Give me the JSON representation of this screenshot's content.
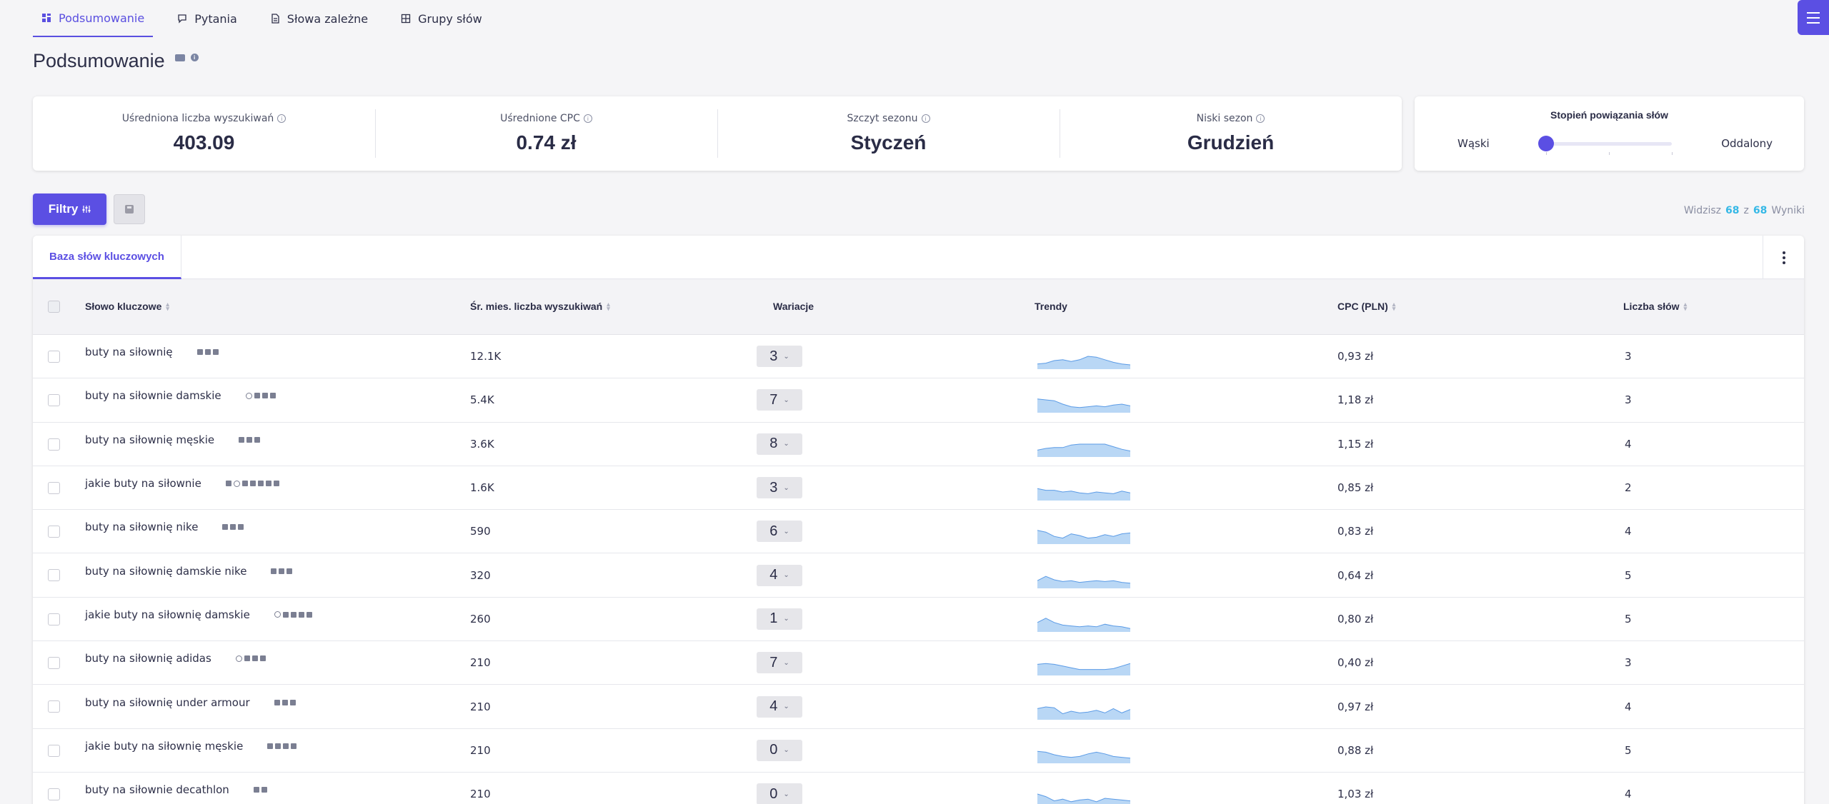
{
  "nav": {
    "tabs": [
      {
        "label": "Podsumowanie",
        "active": true
      },
      {
        "label": "Pytania",
        "active": false
      },
      {
        "label": "Słowa zależne",
        "active": false
      },
      {
        "label": "Grupy słów",
        "active": false
      }
    ]
  },
  "page": {
    "title": "Podsumowanie"
  },
  "stats": [
    {
      "label": "Uśredniona liczba wyszukiwań",
      "value": "403.09"
    },
    {
      "label": "Uśrednione CPC",
      "value": "0.74 zł"
    },
    {
      "label": "Szczyt sezonu",
      "value": "Styczeń"
    },
    {
      "label": "Niski sezon",
      "value": "Grudzień"
    }
  ],
  "relation": {
    "title": "Stopień powiązania słów",
    "left": "Wąski",
    "right": "Oddalony",
    "level": 0
  },
  "toolbar": {
    "filter_label": "Filtry"
  },
  "results": {
    "prefix": "Widzisz",
    "shown": "68",
    "sep": "z",
    "total": "68",
    "suffix": "Wyniki"
  },
  "table": {
    "tab_label": "Baza słów kluczowych",
    "headers": {
      "keyword": "Słowo kluczowe",
      "volume": "Śr. mies. liczba wyszukiwań",
      "variations": "Wariacje",
      "trends": "Trendy",
      "cpc": "CPC (PLN)",
      "words": "Liczba słów"
    },
    "rows": [
      {
        "keyword": "buty na siłownię",
        "icons": [
          "doc",
          "bag",
          "list"
        ],
        "volume": "12.1K",
        "variations": "3",
        "cpc": "0,93 zł",
        "words": "3",
        "trend": [
          0.3,
          0.35,
          0.5,
          0.55,
          0.45,
          0.55,
          0.75,
          0.7,
          0.55,
          0.4,
          0.3,
          0.25
        ]
      },
      {
        "keyword": "buty na siłownie damskie",
        "icons": [
          "google",
          "doc",
          "bag",
          "list"
        ],
        "volume": "5.4K",
        "variations": "7",
        "cpc": "1,18 zł",
        "words": "3",
        "trend": [
          0.8,
          0.75,
          0.7,
          0.5,
          0.35,
          0.3,
          0.35,
          0.4,
          0.35,
          0.45,
          0.5,
          0.4
        ]
      },
      {
        "keyword": "buty na siłownię męskie",
        "icons": [
          "doc",
          "bag",
          "list"
        ],
        "volume": "3.6K",
        "variations": "8",
        "cpc": "1,15 zł",
        "words": "4",
        "trend": [
          0.4,
          0.5,
          0.55,
          0.55,
          0.7,
          0.75,
          0.75,
          0.75,
          0.75,
          0.6,
          0.45,
          0.35
        ]
      },
      {
        "keyword": "jakie buty na siłownie",
        "icons": [
          "chat",
          "google",
          "img",
          "link",
          "bag",
          "list",
          "video"
        ],
        "volume": "1.6K",
        "variations": "3",
        "cpc": "0,85 zł",
        "words": "2",
        "trend": [
          0.7,
          0.6,
          0.6,
          0.5,
          0.55,
          0.45,
          0.4,
          0.5,
          0.45,
          0.4,
          0.55,
          0.45
        ]
      },
      {
        "keyword": "buty na siłownię nike",
        "icons": [
          "doc",
          "bag",
          "list"
        ],
        "volume": "590",
        "variations": "6",
        "cpc": "0,83 zł",
        "words": "4",
        "trend": [
          0.8,
          0.7,
          0.45,
          0.35,
          0.6,
          0.5,
          0.35,
          0.4,
          0.55,
          0.45,
          0.6,
          0.65
        ]
      },
      {
        "keyword": "buty na siłownię damskie nike",
        "icons": [
          "doc",
          "bag",
          "list"
        ],
        "volume": "320",
        "variations": "4",
        "cpc": "0,64 zł",
        "words": "5",
        "trend": [
          0.45,
          0.7,
          0.5,
          0.4,
          0.45,
          0.35,
          0.4,
          0.45,
          0.4,
          0.45,
          0.35,
          0.3
        ]
      },
      {
        "keyword": "jakie buty na siłownię damskie",
        "icons": [
          "google",
          "img",
          "link",
          "bag",
          "list"
        ],
        "volume": "260",
        "variations": "1",
        "cpc": "0,80 zł",
        "words": "5",
        "trend": [
          0.55,
          0.8,
          0.55,
          0.4,
          0.35,
          0.3,
          0.35,
          0.3,
          0.45,
          0.35,
          0.3,
          0.2
        ]
      },
      {
        "keyword": "buty na siłownię adidas",
        "icons": [
          "google",
          "doc",
          "bag",
          "list"
        ],
        "volume": "210",
        "variations": "7",
        "cpc": "0,40 zł",
        "words": "3",
        "trend": [
          0.65,
          0.7,
          0.65,
          0.55,
          0.45,
          0.35,
          0.35,
          0.35,
          0.35,
          0.4,
          0.55,
          0.7
        ]
      },
      {
        "keyword": "buty na siłownię under armour",
        "icons": [
          "doc",
          "bag",
          "list"
        ],
        "volume": "210",
        "variations": "4",
        "cpc": "0,97 zł",
        "words": "4",
        "trend": [
          0.65,
          0.75,
          0.7,
          0.35,
          0.5,
          0.4,
          0.45,
          0.55,
          0.4,
          0.65,
          0.4,
          0.6
        ]
      },
      {
        "keyword": "jakie buty na siłownię męskie",
        "icons": [
          "img",
          "link",
          "bag",
          "list"
        ],
        "volume": "210",
        "variations": "0",
        "cpc": "0,88 zł",
        "words": "5",
        "trend": [
          0.7,
          0.65,
          0.5,
          0.4,
          0.35,
          0.4,
          0.55,
          0.65,
          0.55,
          0.4,
          0.35,
          0.3
        ]
      },
      {
        "keyword": "buty na siłownie decathlon",
        "icons": [
          "link",
          "edit"
        ],
        "volume": "210",
        "variations": "0",
        "cpc": "1,03 zł",
        "words": "4",
        "trend": [
          0.75,
          0.6,
          0.35,
          0.45,
          0.3,
          0.4,
          0.45,
          0.3,
          0.5,
          0.45,
          0.4,
          0.35
        ]
      }
    ]
  },
  "colors": {
    "accent": "#5b4fe3",
    "trend_fill": "#b9d7f5",
    "trend_line": "#5b9be6",
    "result_num": "#35b8e6"
  }
}
